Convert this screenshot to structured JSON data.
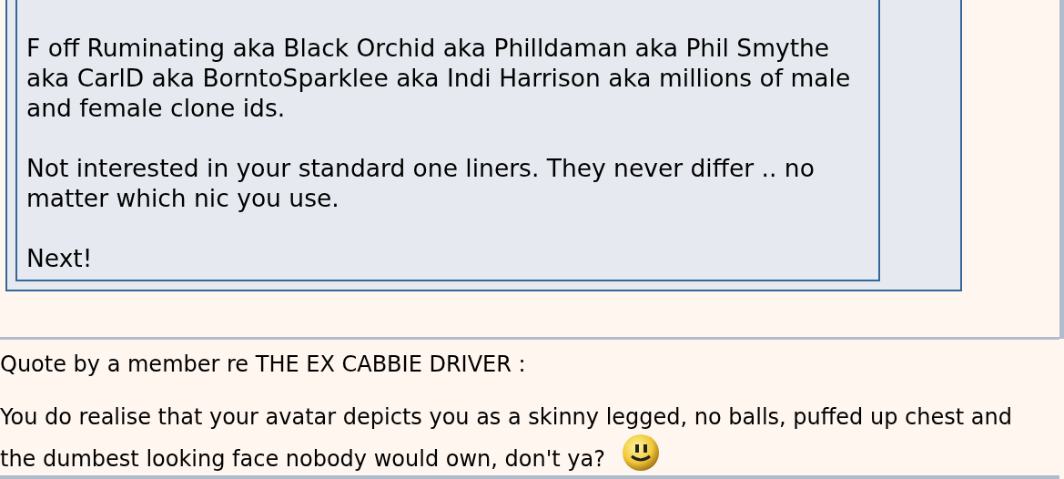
{
  "quote_box": {
    "paragraphs": [
      {
        "lines": [
          "F off Ruminating aka Black Orchid aka Philldaman aka Phil Smythe",
          "aka CarlD aka BorntoSparklee aka Indi Harrison aka millions of male",
          "and female clone ids."
        ]
      },
      {
        "lines": [
          "Not interested in your standard one liners. They never differ .. no",
          "matter which nic you use."
        ]
      },
      {
        "lines": [
          "Next!"
        ]
      }
    ]
  },
  "post": {
    "heading": "Quote by a member re THE EX CABBIE DRIVER :",
    "quote_lines": [
      "You do realise that your avatar depicts you as a skinny legged, no balls, puffed up chest and",
      "the dumbest looking face nobody would own, don't ya?"
    ],
    "smiley": true
  }
}
